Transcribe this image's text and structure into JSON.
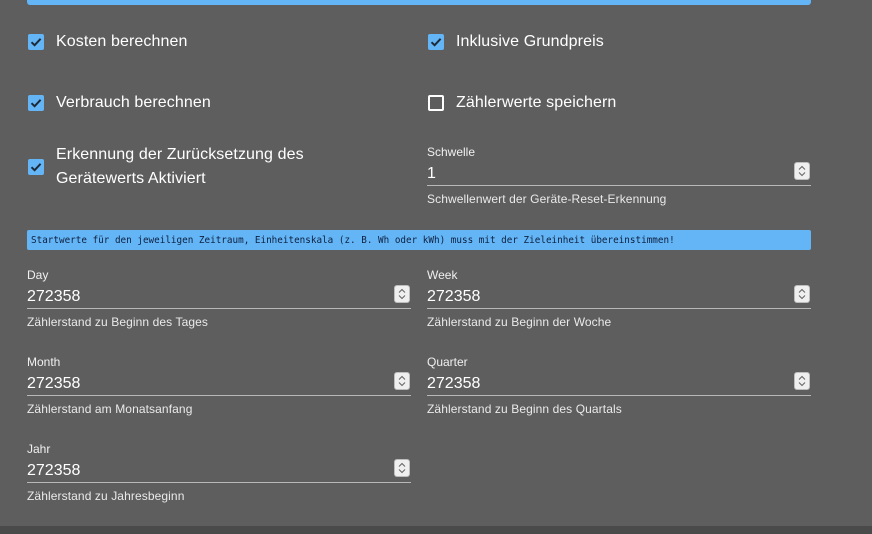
{
  "checkboxes": {
    "kosten": {
      "label": "Kosten berechnen",
      "checked": true
    },
    "grundpreis": {
      "label": "Inklusive Grundpreis",
      "checked": true
    },
    "verbrauch": {
      "label": "Verbrauch berechnen",
      "checked": true
    },
    "zaehlerwerte": {
      "label": "Zählerwerte speichern",
      "checked": false
    },
    "reset": {
      "label_line1": "Erkennung der Zurücksetzung des",
      "label_line2": "Gerätewerts Aktiviert",
      "checked": true
    }
  },
  "schwelle": {
    "label": "Schwelle",
    "value": "1",
    "helper": "Schwellenwert der Geräte-Reset-Erkennung"
  },
  "banner": {
    "text": "Startwerte für den jeweiligen Zeitraum, Einheitenskala (z. B. Wh oder kWh) muss mit der Zieleinheit übereinstimmen!"
  },
  "start_values": {
    "day": {
      "label": "Day",
      "value": "272358",
      "helper": "Zählerstand zu Beginn des Tages"
    },
    "week": {
      "label": "Week",
      "value": "272358",
      "helper": "Zählerstand zu Beginn der Woche"
    },
    "month": {
      "label": "Month",
      "value": "272358",
      "helper": "Zählerstand am Monatsanfang"
    },
    "quarter": {
      "label": "Quarter",
      "value": "272358",
      "helper": "Zählerstand zu Beginn des Quartals"
    },
    "jahr": {
      "label": "Jahr",
      "value": "272358",
      "helper": "Zählerstand zu Jahresbeginn"
    }
  },
  "colors": {
    "background": "#5f5e5f",
    "accent": "#64b5f6"
  }
}
